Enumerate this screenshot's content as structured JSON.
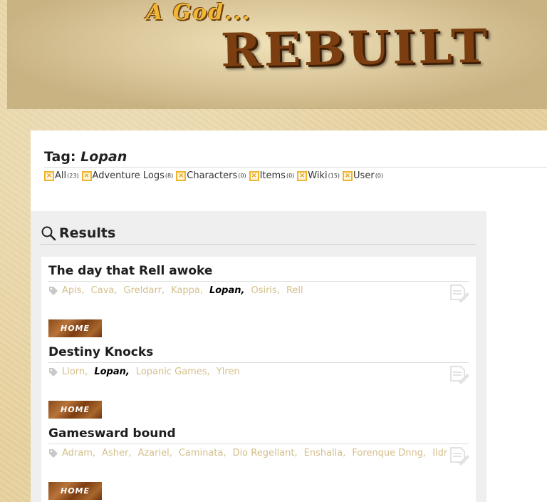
{
  "banner": {
    "subtitle": "A God...",
    "title": "REBUILT"
  },
  "tag_page": {
    "label": "Tag:",
    "tag_name": "Lopan"
  },
  "filters": [
    {
      "label": "All",
      "count": "(23)"
    },
    {
      "label": "Adventure Logs",
      "count": "(8)"
    },
    {
      "label": "Characters",
      "count": "(0)"
    },
    {
      "label": "Items",
      "count": "(0)"
    },
    {
      "label": "Wiki",
      "count": "(15)"
    },
    {
      "label": "User",
      "count": "(0)"
    }
  ],
  "results": {
    "heading": "Results",
    "items": [
      {
        "title": "The day that Rell awoke",
        "tags": [
          "Apis",
          "Cava",
          "Greldarr",
          "Kappa",
          "Lopan",
          "Osiris",
          "Rell"
        ],
        "button": "HOME"
      },
      {
        "title": "Destiny Knocks",
        "tags": [
          "Llorn",
          "Lopan",
          "Lopanic Games",
          "Ylren"
        ],
        "button": "HOME"
      },
      {
        "title": "Gamesward bound",
        "tags": [
          "Adram",
          "Asher",
          "Azariel",
          "Caminata",
          "Dio Regellant",
          "Enshalla",
          "Forenque Dnng",
          "Ildr"
        ],
        "button": "HOME"
      }
    ]
  },
  "colors": {
    "parchment": "#e7d29f",
    "tag_link": "#d4bf8a",
    "filter_box": "#f0b52d",
    "home_button": "#8a4a1a"
  },
  "icons": {
    "search": "search-icon",
    "tag": "tag-icon",
    "document": "document-edit-icon",
    "filter_remove": "x-box-icon"
  }
}
